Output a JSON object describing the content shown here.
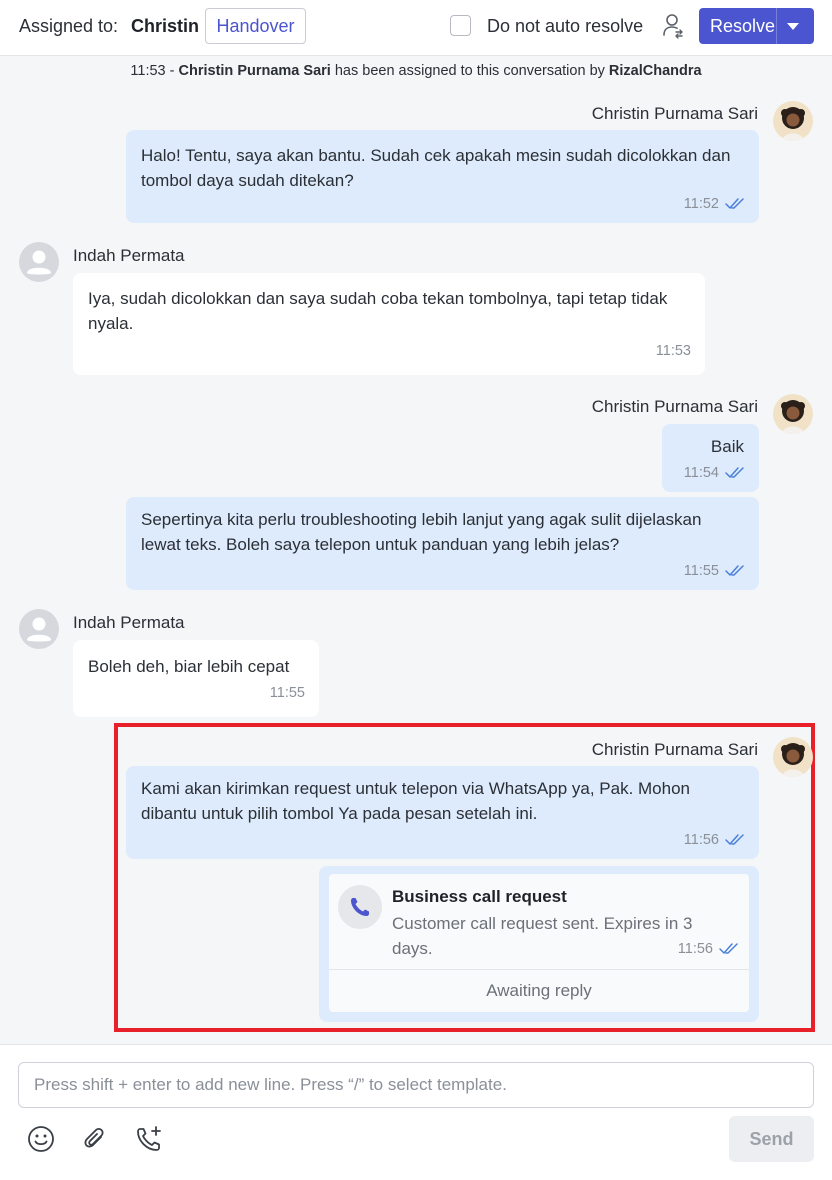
{
  "header": {
    "assigned_label": "Assigned to:",
    "assigned_name": "Christin",
    "handover_label": "Handover",
    "auto_resolve_label": "Do not auto resolve",
    "resolve_label": "Resolve",
    "accent_color": "#4a55cf"
  },
  "system_message": {
    "time": "11:53",
    "separator": "-",
    "agent": "Christin Purnama Sari",
    "text": "has been assigned to this conversation by",
    "assigner": "RizalChandra"
  },
  "messages": [
    {
      "sender": "Christin Purnama Sari",
      "direction": "out",
      "text": "Halo! Tentu, saya akan bantu. Sudah cek apakah mesin sudah dicolokkan dan tombol daya sudah ditekan?",
      "time": "11:52",
      "status": "read"
    },
    {
      "sender": "Indah Permata",
      "direction": "in",
      "text": "Iya, sudah dicolokkan dan saya sudah coba tekan tombolnya, tapi tetap tidak nyala.",
      "time": "11:53"
    },
    {
      "sender": "Christin Purnama Sari",
      "direction": "out",
      "text": "Baik",
      "time": "11:54",
      "status": "read"
    },
    {
      "sender": "",
      "direction": "out",
      "text": "Sepertinya kita perlu troubleshooting lebih lanjut yang agak sulit dijelaskan lewat teks. Boleh saya telepon untuk panduan yang lebih jelas?",
      "time": "11:55",
      "status": "read"
    },
    {
      "sender": "Indah Permata",
      "direction": "in",
      "text": "Boleh deh, biar lebih cepat",
      "time": "11:55"
    },
    {
      "sender": "Christin Purnama Sari",
      "direction": "out",
      "text": "Kami akan kirimkan request untuk telepon via WhatsApp ya, Pak. Mohon dibantu untuk pilih tombol Ya pada pesan setelah ini.",
      "time": "11:56",
      "status": "read"
    }
  ],
  "call_request": {
    "title": "Business call request",
    "description": "Customer call request sent. Expires in 3 days.",
    "time": "11:56",
    "status": "read",
    "footer": "Awaiting reply",
    "icon": "phone-icon"
  },
  "composer": {
    "placeholder": "Press shift + enter to add new line. Press “/” to select template.",
    "send_label": "Send",
    "tools": [
      "emoji-icon",
      "paperclip-icon",
      "phone-plus-icon"
    ]
  },
  "colors": {
    "outgoing_bubble": "#deebfc",
    "incoming_bubble": "#ffffff",
    "highlight": "#e8202a",
    "read_tick": "#4a7fd8"
  }
}
